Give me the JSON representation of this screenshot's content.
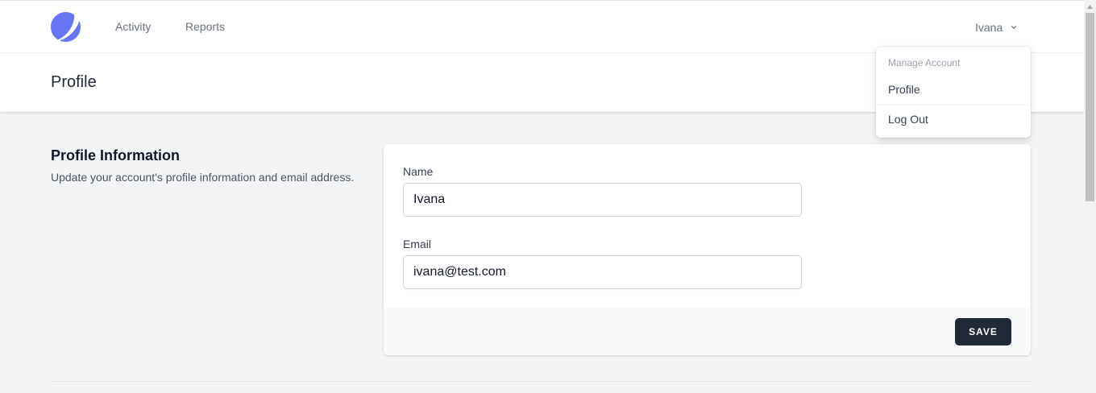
{
  "nav": {
    "links": [
      "Activity",
      "Reports"
    ],
    "user_name": "Ivana"
  },
  "dropdown": {
    "header": "Manage Account",
    "items": [
      "Profile",
      "Log Out"
    ]
  },
  "header": {
    "title": "Profile"
  },
  "profile_section": {
    "title": "Profile Information",
    "description": "Update your account's profile information and email address.",
    "name_label": "Name",
    "name_value": "Ivana",
    "email_label": "Email",
    "email_value": "ivana@test.com",
    "save_label": "SAVE"
  },
  "colors": {
    "logo": "#6366f1",
    "save_button": "#1f2937"
  },
  "icons": [
    "logo-icon",
    "chevron-down-icon"
  ]
}
